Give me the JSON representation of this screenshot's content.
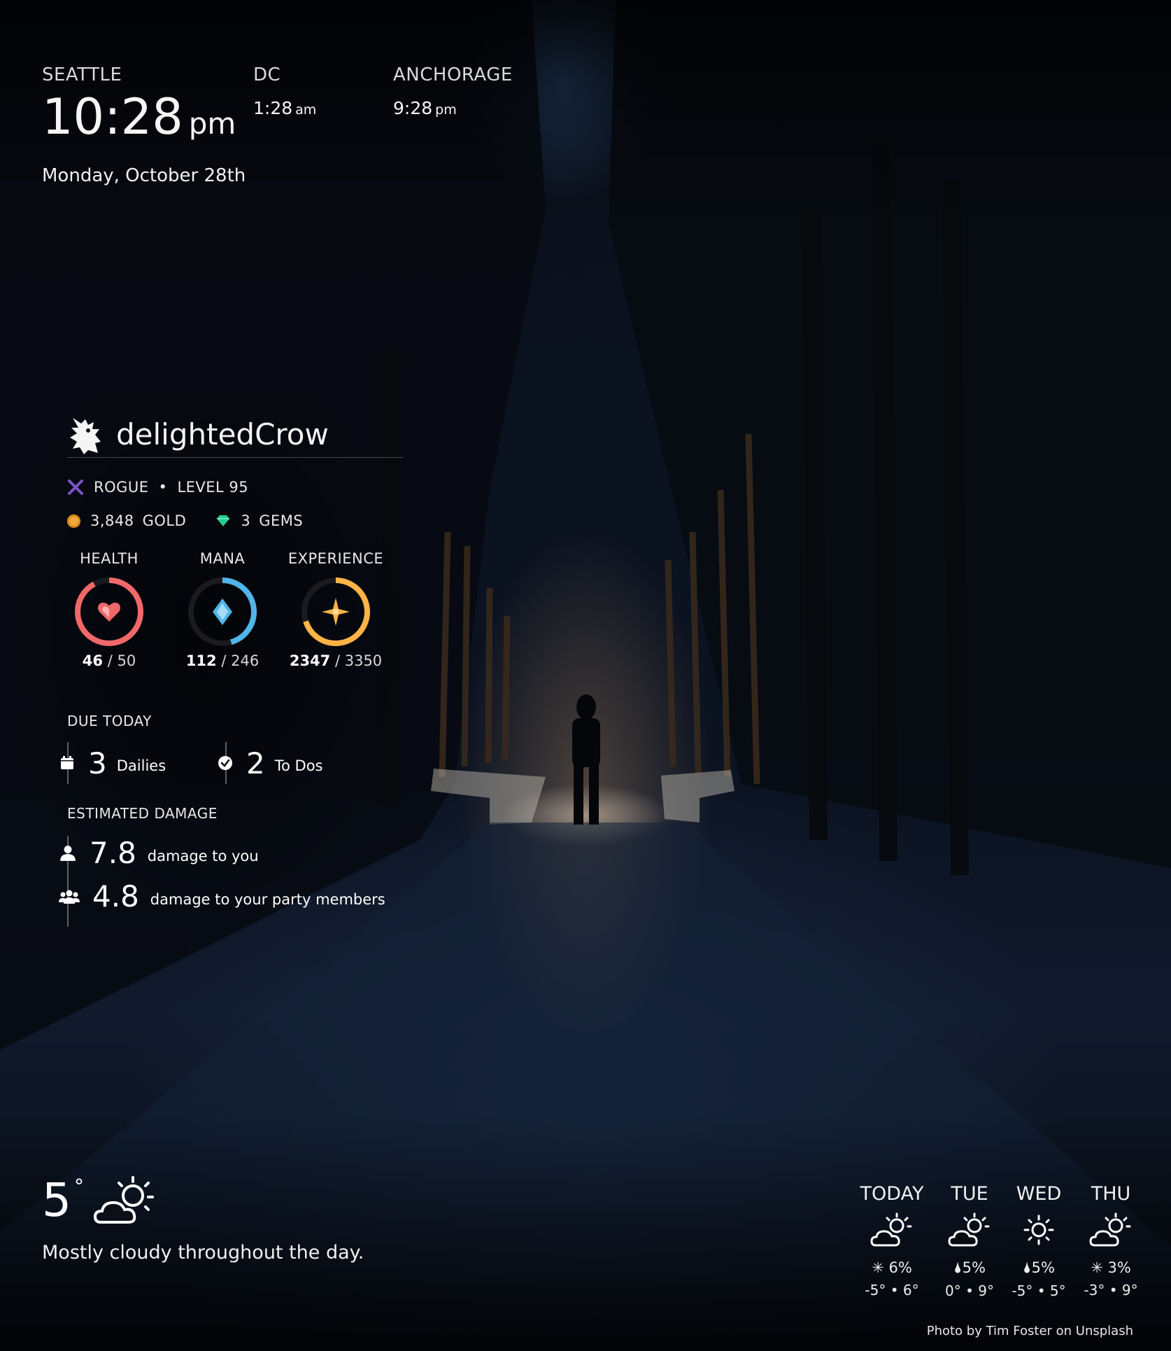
{
  "clocks": [
    {
      "city": "SEATTLE",
      "time": "10:28",
      "ampm": "pm",
      "date": "Monday, October 28th"
    },
    {
      "city": "DC",
      "time": "1:28",
      "ampm": "am"
    },
    {
      "city": "ANCHORAGE",
      "time": "9:28",
      "ampm": "pm"
    }
  ],
  "habitica": {
    "username": "delightedCrow",
    "class": "ROGUE",
    "level_label": "LEVEL 95",
    "gold": "3,848",
    "gold_label": "GOLD",
    "gems": "3",
    "gems_label": "GEMS",
    "stats": [
      {
        "label": "HEALTH",
        "current": "46",
        "max": "/ 50",
        "fraction": 0.92,
        "color": "#f0686a",
        "icon": "heart-icon"
      },
      {
        "label": "MANA",
        "current": "112",
        "max": "/ 246",
        "fraction": 0.455,
        "color": "#50b5e9",
        "icon": "diamond-icon"
      },
      {
        "label": "EXPERIENCE",
        "current": "2347",
        "max": "/ 3350",
        "fraction": 0.7,
        "color": "#ffb445",
        "icon": "star-icon"
      }
    ],
    "due_title": "DUE TODAY",
    "dailies": {
      "count": "3",
      "label": "Dailies"
    },
    "todos": {
      "count": "2",
      "label": "To Dos"
    },
    "damage_title": "ESTIMATED DAMAGE",
    "damage_you": {
      "value": "7.8",
      "label": "damage to you"
    },
    "damage_party": {
      "value": "4.8",
      "label": "damage to your party members"
    }
  },
  "weather": {
    "temp": "5",
    "deg": "°",
    "summary": "Mostly cloudy throughout the day.",
    "forecast": [
      {
        "day": "TODAY",
        "icon": "partly-cloudy-icon",
        "precip_icon": "snow",
        "precip": "6%",
        "range": "-5° • 6°"
      },
      {
        "day": "TUE",
        "icon": "partly-cloudy-icon",
        "precip_icon": "rain",
        "precip": "5%",
        "range": "0° • 9°"
      },
      {
        "day": "WED",
        "icon": "sun-icon",
        "precip_icon": "rain",
        "precip": "5%",
        "range": "-5° • 5°"
      },
      {
        "day": "THU",
        "icon": "partly-cloudy-icon",
        "precip_icon": "snow",
        "precip": "3%",
        "range": "-3° • 9°"
      }
    ]
  },
  "credit": "Photo by Tim Foster on Unsplash",
  "colors": {
    "health": "#f0686a",
    "mana": "#50b5e9",
    "experience": "#ffb445",
    "gold": "#f2a93b",
    "gem": "#24cc8f",
    "rogue": "#6133b4"
  }
}
